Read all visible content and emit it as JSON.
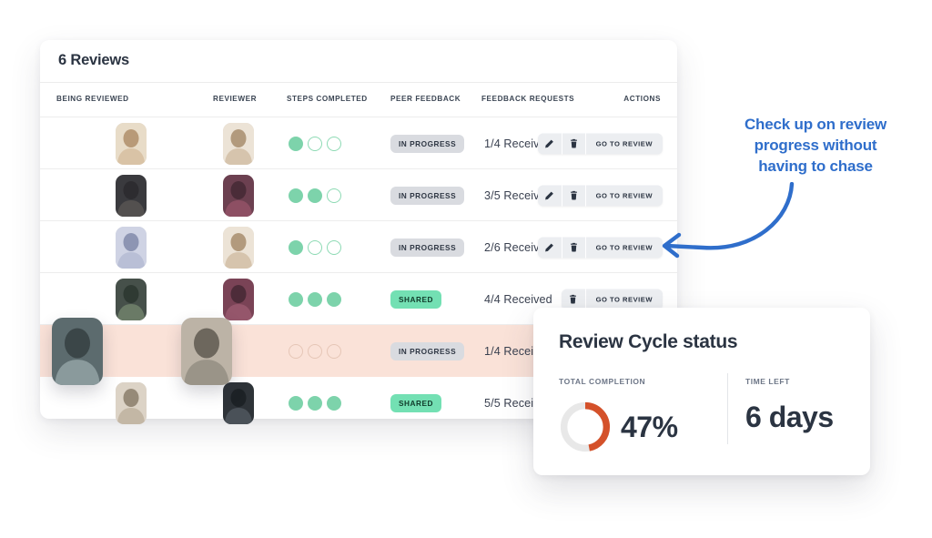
{
  "table": {
    "title": "6 Reviews",
    "columns": [
      "BEING REVIEWED",
      "REVIEWER",
      "STEPS COMPLETED",
      "PEER FEEDBACK",
      "FEEDBACK REQUESTS",
      "ACTIONS"
    ],
    "rows": [
      {
        "steps_total": 3,
        "steps_done": 1,
        "peer_feedback": "IN PROGRESS",
        "feedback_state": "progress",
        "feedback_requests": "1/4 Received",
        "actions": {
          "edit": "edit-icon",
          "delete": "trash-icon",
          "go": "GO TO REVIEW"
        },
        "highlighted": false
      },
      {
        "steps_total": 3,
        "steps_done": 2,
        "peer_feedback": "IN PROGRESS",
        "feedback_state": "progress",
        "feedback_requests": "3/5 Received",
        "actions": {
          "edit": "edit-icon",
          "delete": "trash-icon",
          "go": "GO TO REVIEW"
        },
        "highlighted": false
      },
      {
        "steps_total": 3,
        "steps_done": 1,
        "peer_feedback": "IN PROGRESS",
        "feedback_state": "progress",
        "feedback_requests": "2/6 Received",
        "actions": {
          "edit": "edit-icon",
          "delete": "trash-icon",
          "go": "GO TO REVIEW"
        },
        "highlighted": false
      },
      {
        "steps_total": 3,
        "steps_done": 3,
        "peer_feedback": "SHARED",
        "feedback_state": "shared",
        "feedback_requests": "4/4 Received",
        "actions": {
          "edit": null,
          "delete": "trash-icon",
          "go": "GO TO REVIEW"
        },
        "highlighted": false
      },
      {
        "steps_total": 3,
        "steps_done": 0,
        "peer_feedback": "IN PROGRESS",
        "feedback_state": "progress",
        "feedback_requests": "1/4 Received",
        "actions": {
          "edit": null,
          "delete": null,
          "go": null
        },
        "highlighted": true
      },
      {
        "steps_total": 3,
        "steps_done": 3,
        "peer_feedback": "SHARED",
        "feedback_state": "shared",
        "feedback_requests": "5/5 Received",
        "actions": {
          "edit": null,
          "delete": null,
          "go": null
        },
        "highlighted": false
      }
    ]
  },
  "status_card": {
    "title": "Review Cycle status",
    "completion": {
      "label": "TOTAL COMPLETION",
      "value": "47%",
      "percent": 47
    },
    "time_left": {
      "label": "TIME LEFT",
      "value": "6 days"
    }
  },
  "annotation": {
    "line1": "Check up on review",
    "line2": "progress without",
    "line3": "having to chase"
  },
  "colors": {
    "mint": "#7dd3ab",
    "shared_badge": "#73e0b3",
    "progress_badge": "#d9dbe0",
    "highlight_row": "#fae2d8",
    "donut_arc": "#d4512a",
    "donut_track": "#e8e8e8",
    "annotation_blue": "#2f6ecb",
    "text_dark": "#2b3442"
  }
}
